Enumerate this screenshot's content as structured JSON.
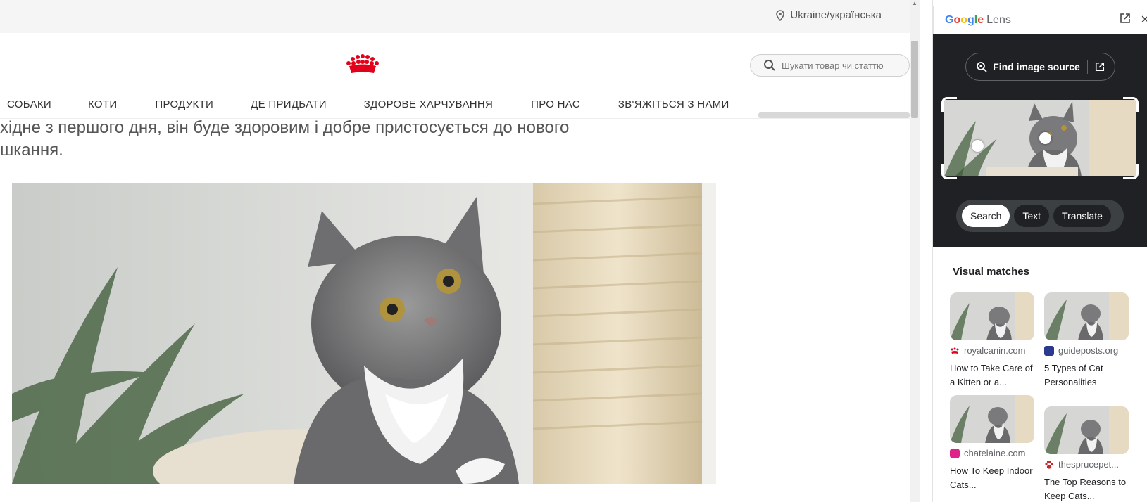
{
  "site": {
    "region": "Ukraine/українська",
    "search_placeholder": "Шукати товар чи статтю",
    "nav": [
      "СОБАКИ",
      "КОТИ",
      "ПРОДУКТИ",
      "ДЕ ПРИДБАТИ",
      "ЗДОРОВЕ ХАРЧУВАННЯ",
      "ПРО НАС",
      "ЗВ'ЯЖІТЬСЯ З НАМИ"
    ],
    "intro_line1": "хідне з першого дня, він буде здоровим і добре пристосується до нового",
    "intro_line2": "шкання.",
    "hero_alt": "grey kitten on cat tree",
    "brand_color": "#e2001a"
  },
  "lens": {
    "logo_word": "Google",
    "logo_suffix": "Lens",
    "find_source_label": "Find image source",
    "modes": [
      "Search",
      "Text",
      "Translate"
    ],
    "active_mode": "Search",
    "visual_matches_title": "Visual matches",
    "results": [
      {
        "site": "royalcanin.com",
        "title": "How to Take Care of a Kitten or a...",
        "favicon_color": "#e2001a"
      },
      {
        "site": "guideposts.org",
        "title": "5 Types of Cat Personalities",
        "favicon_color": "#2b3a8f"
      },
      {
        "site": "chatelaine.com",
        "title": "How To Keep Indoor Cats...",
        "favicon_color": "#e0218a"
      },
      {
        "site": "thesprucepet...",
        "title": "The Top Reasons to Keep Cats...",
        "favicon_color": "#c62828"
      }
    ]
  }
}
